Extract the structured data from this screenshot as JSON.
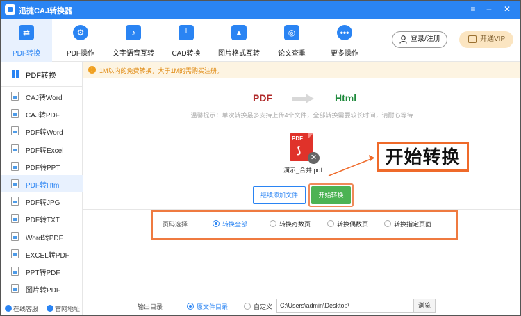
{
  "app": {
    "title": "迅捷CAJ转换器"
  },
  "toolbar": {
    "tabs": [
      {
        "label": "PDF转换",
        "icon": "swap-icon"
      },
      {
        "label": "PDF操作",
        "icon": "gear-icon"
      },
      {
        "label": "文字语音互转",
        "icon": "audio-icon"
      },
      {
        "label": "CAD转换",
        "icon": "cad-icon"
      },
      {
        "label": "图片格式互转",
        "icon": "image-icon"
      },
      {
        "label": "论文查重",
        "icon": "check-icon"
      },
      {
        "label": "更多操作",
        "icon": "more-icon"
      }
    ],
    "login_label": "登录/注册",
    "vip_label": "开通VIP"
  },
  "sidebar": {
    "header": "PDF转换",
    "items": [
      {
        "label": "CAJ转Word"
      },
      {
        "label": "CAJ转PDF"
      },
      {
        "label": "PDF转Word"
      },
      {
        "label": "PDF转Excel"
      },
      {
        "label": "PDF转PPT"
      },
      {
        "label": "PDF转Html"
      },
      {
        "label": "PDF转JPG"
      },
      {
        "label": "PDF转TXT"
      },
      {
        "label": "Word转PDF"
      },
      {
        "label": "EXCEL转PDF"
      },
      {
        "label": "PPT转PDF"
      },
      {
        "label": "图片转PDF"
      }
    ],
    "active_index": 5,
    "footer": {
      "service": "在线客服",
      "website": "官网地址"
    }
  },
  "notice": "1M以内的免费转换，大于1M的需购买注册。",
  "main": {
    "from_format": "PDF",
    "to_format": "Html",
    "hint": "温馨提示：单次转换最多支持上传4个文件，全部转换需要较长时间，请耐心等待",
    "file": {
      "name": "演示_合并.pdf",
      "type_label": "PDF"
    },
    "callout": "开始转换",
    "add_button": "继续添加文件",
    "start_button": "开始转换",
    "page_select": {
      "label": "页码选择",
      "options": [
        "转换全部",
        "转换奇数页",
        "转换偶数页",
        "转换指定页面"
      ],
      "selected": "转换全部"
    },
    "output": {
      "label": "输出目录",
      "options": [
        "原文件目录",
        "自定义"
      ],
      "selected": "原文件目录",
      "path": "C:\\Users\\admin\\Desktop\\",
      "browse_label": "浏览"
    }
  },
  "colors": {
    "accent": "#2a84f3",
    "start_green": "#4cb354",
    "highlight_orange": "#ef6a2a"
  }
}
